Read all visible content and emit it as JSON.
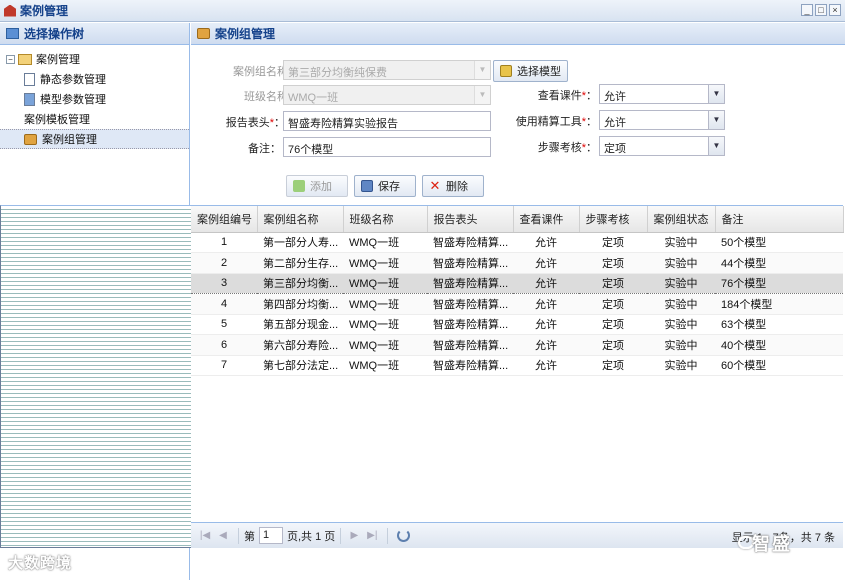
{
  "window": {
    "title": "案例管理",
    "controls": [
      "_",
      "□",
      "×"
    ]
  },
  "left_panel": {
    "title": "选择操作树",
    "tree": {
      "root_label": "案例管理",
      "items": [
        {
          "label": "静态参数管理",
          "icon": "list-doc-icon"
        },
        {
          "label": "模型参数管理",
          "icon": "blue-doc-icon"
        },
        {
          "label": "案例模板管理",
          "icon": "template-doc-icon"
        },
        {
          "label": "案例组管理",
          "icon": "briefcase-icon",
          "selected": true
        }
      ]
    }
  },
  "right_panel": {
    "title": "案例组管理",
    "form": {
      "group_name_label": "案例组名称：",
      "group_name_value": "第三部分均衡纯保费",
      "class_name_label": "班级名称：",
      "class_name_value": "WMQ一班",
      "report_header_label": "报告表头",
      "report_header_value": "智盛寿险精算实验报告",
      "notes_label": "备注：",
      "notes_value": "76个模型",
      "select_model_button": "选择模型",
      "view_courseware_label": "查看课件",
      "view_courseware_value": "允许",
      "use_tool_label": "使用精算工具",
      "use_tool_value": "允许",
      "step_check_label": "步骤考核",
      "step_check_value": "定项",
      "required_mark": "*",
      "colon": "："
    },
    "toolbar": {
      "add_label": "添加",
      "save_label": "保存",
      "delete_label": "删除"
    },
    "table": {
      "columns": [
        "案例组编号",
        "案例组名称",
        "班级名称",
        "报告表头",
        "查看课件",
        "步骤考核",
        "案例组状态",
        "备注"
      ],
      "rows": [
        [
          "1",
          "第一部分人寿...",
          "WMQ一班",
          "智盛寿险精算...",
          "允许",
          "定项",
          "实验中",
          "50个模型"
        ],
        [
          "2",
          "第二部分生存...",
          "WMQ一班",
          "智盛寿险精算...",
          "允许",
          "定项",
          "实验中",
          "44个模型"
        ],
        [
          "3",
          "第三部分均衡...",
          "WMQ一班",
          "智盛寿险精算...",
          "允许",
          "定项",
          "实验中",
          "76个模型"
        ],
        [
          "4",
          "第四部分均衡...",
          "WMQ一班",
          "智盛寿险精算...",
          "允许",
          "定项",
          "实验中",
          "184个模型"
        ],
        [
          "5",
          "第五部分现金...",
          "WMQ一班",
          "智盛寿险精算...",
          "允许",
          "定项",
          "实验中",
          "63个模型"
        ],
        [
          "6",
          "第六部分寿险...",
          "WMQ一班",
          "智盛寿险精算...",
          "允许",
          "定项",
          "实验中",
          "40个模型"
        ],
        [
          "7",
          "第七部分法定...",
          "WMQ一班",
          "智盛寿险精算...",
          "允许",
          "定项",
          "实验中",
          "60个模型"
        ]
      ],
      "selected_row": 3
    },
    "pager": {
      "page_prefix": "第",
      "page_value": "1",
      "page_suffix": "页,共 1 页",
      "summary": "显示 1 - 7条，共 7 条"
    }
  },
  "watermarks": {
    "left": "大数跨境",
    "right": "智盛"
  }
}
